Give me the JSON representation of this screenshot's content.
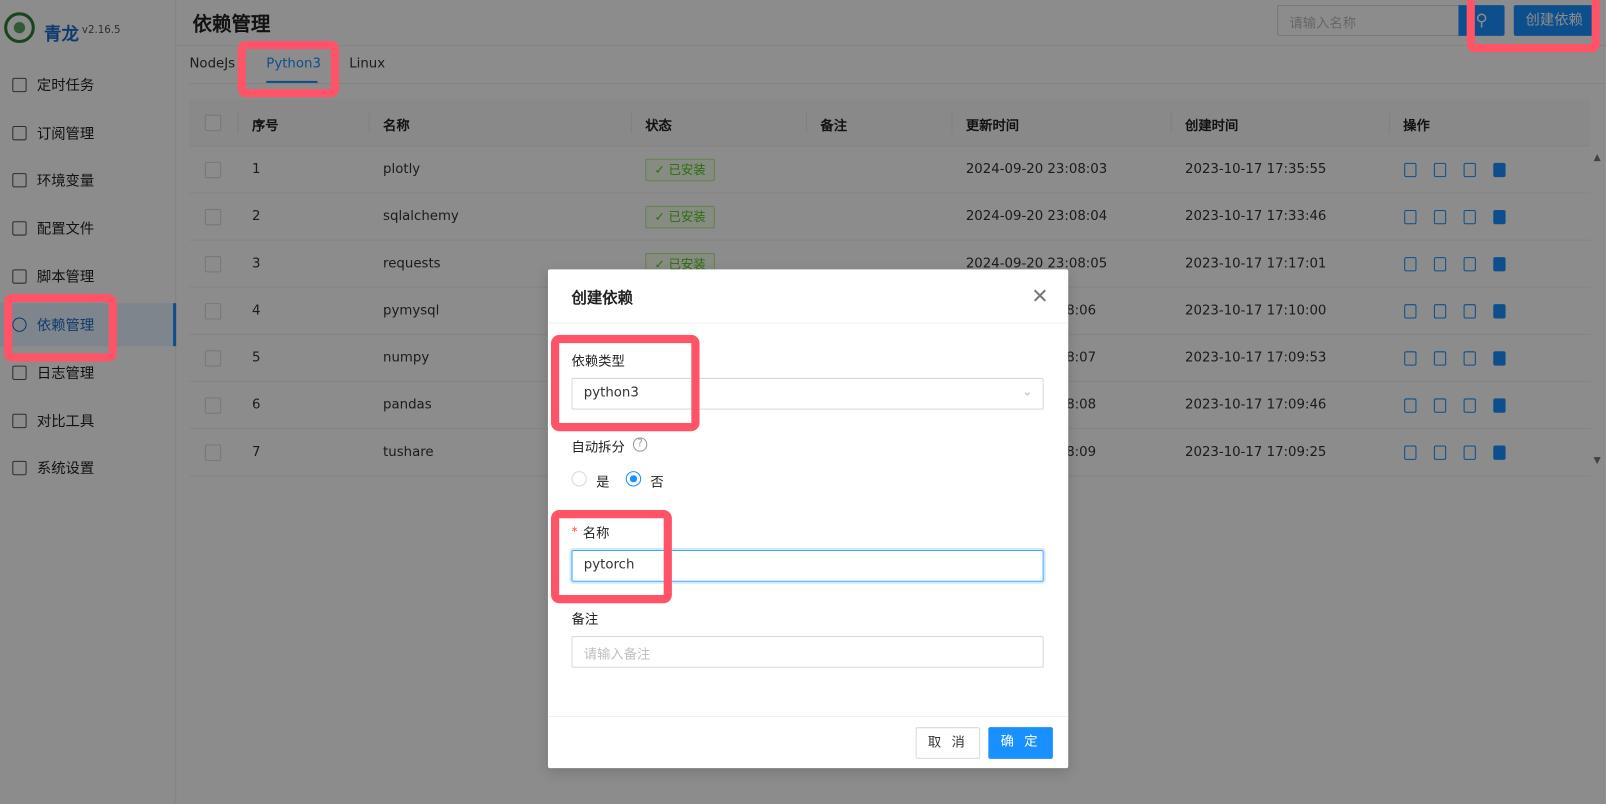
{
  "app": {
    "name": "青龙",
    "version": "v2.16.5"
  },
  "sidebar": {
    "items": [
      {
        "label": "定时任务",
        "icon": "clock-list-icon"
      },
      {
        "label": "订阅管理",
        "icon": "subscription-icon"
      },
      {
        "label": "环境变量",
        "icon": "monitor-icon"
      },
      {
        "label": "配置文件",
        "icon": "sliders-icon"
      },
      {
        "label": "脚本管理",
        "icon": "script-icon"
      },
      {
        "label": "依赖管理",
        "icon": "database-icon",
        "active": true
      },
      {
        "label": "日志管理",
        "icon": "log-icon"
      },
      {
        "label": "对比工具",
        "icon": "diff-icon"
      },
      {
        "label": "系统设置",
        "icon": "gear-icon"
      }
    ]
  },
  "header": {
    "title": "依赖管理",
    "search_placeholder": "请输入名称",
    "create_label": "创建依赖"
  },
  "tabs": [
    {
      "label": "NodeJs"
    },
    {
      "label": "Python3",
      "active": true
    },
    {
      "label": "Linux"
    }
  ],
  "table": {
    "columns": [
      "序号",
      "名称",
      "状态",
      "备注",
      "更新时间",
      "创建时间",
      "操作"
    ],
    "rows": [
      {
        "no": "1",
        "name": "plotly",
        "status": "已安装",
        "remark": "",
        "updated": "2024-09-20 23:08:03",
        "created": "2023-10-17 17:35:55"
      },
      {
        "no": "2",
        "name": "sqlalchemy",
        "status": "已安装",
        "remark": "",
        "updated": "2024-09-20 23:08:04",
        "created": "2023-10-17 17:33:46"
      },
      {
        "no": "3",
        "name": "requests",
        "status": "已安装",
        "remark": "",
        "updated": "2024-09-20 23:08:05",
        "created": "2023-10-17 17:17:01"
      },
      {
        "no": "4",
        "name": "pymysql",
        "status": "",
        "remark": "",
        "updated": "8:06",
        "created": "2023-10-17 17:10:00"
      },
      {
        "no": "5",
        "name": "numpy",
        "status": "",
        "remark": "",
        "updated": "8:07",
        "created": "2023-10-17 17:09:53"
      },
      {
        "no": "6",
        "name": "pandas",
        "status": "",
        "remark": "",
        "updated": "8:08",
        "created": "2023-10-17 17:09:46"
      },
      {
        "no": "7",
        "name": "tushare",
        "status": "",
        "remark": "",
        "updated": "8:09",
        "created": "2023-10-17 17:09:25"
      }
    ],
    "actions": [
      "log-icon",
      "debug-icon",
      "uninstall-icon",
      "delete-icon"
    ]
  },
  "modal": {
    "title": "创建依赖",
    "type_label": "依赖类型",
    "type_value": "python3",
    "split_label": "自动拆分",
    "split_options": [
      "是",
      "否"
    ],
    "split_selected": "否",
    "name_label": "名称",
    "name_value": "pytorch",
    "remark_label": "备注",
    "remark_placeholder": "请输入备注",
    "cancel_label": "取 消",
    "ok_label": "确 定"
  },
  "colors": {
    "primary": "#1890ff",
    "annotation": "#ff5468",
    "success": "#52c41a"
  }
}
